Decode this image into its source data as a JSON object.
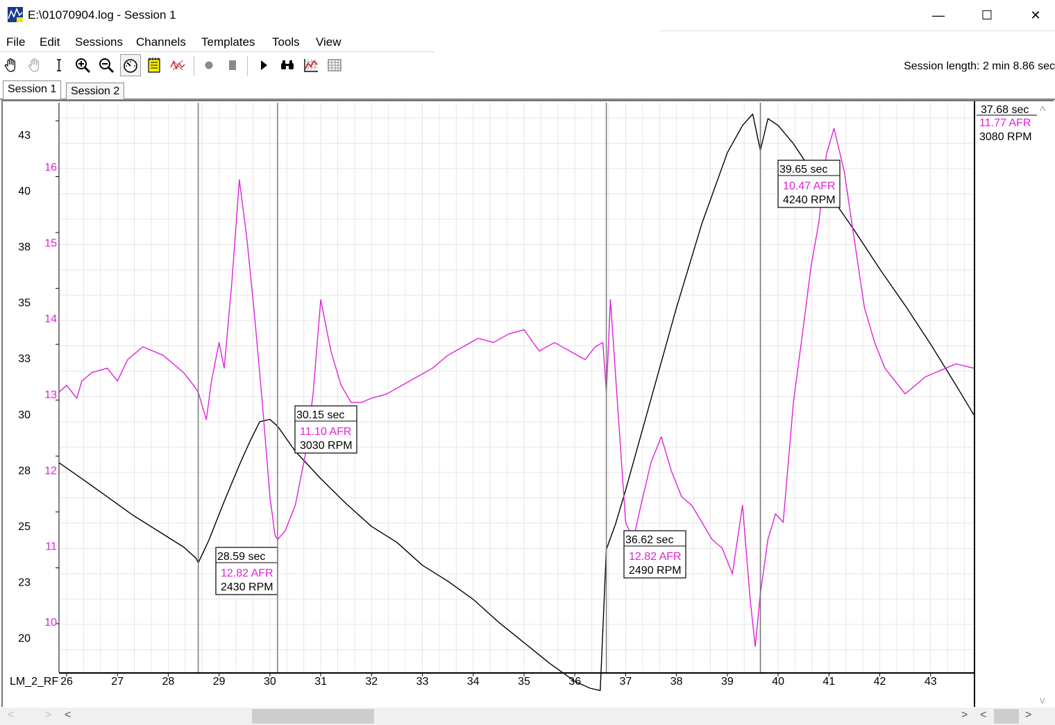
{
  "window": {
    "title": "E:\\01070904.log - Session 1",
    "minimize_glyph": "—",
    "maximize_glyph": "☐",
    "close_glyph": "✕"
  },
  "menu": [
    "File",
    "Edit",
    "Sessions",
    "Channels",
    "Templates",
    "Tools",
    "View"
  ],
  "toolbar": {
    "buttons": [
      "hand-pan",
      "hand-disabled",
      "text-cursor",
      "zoom-in",
      "zoom-out",
      "gauge",
      "notepad",
      "signal-fade",
      "record",
      "stop",
      "play",
      "binoculars",
      "chart-export",
      "table-grid"
    ],
    "pressed": "gauge",
    "session_length_label": "Session length:",
    "session_length_value": "2 min 8.86 sec"
  },
  "tabs": [
    "Session 1",
    "Session 2"
  ],
  "active_tab": "Session 1",
  "chart_data": {
    "type": "line",
    "x_axis": {
      "label": "LM_2_RF",
      "range": [
        25.85,
        43.85
      ],
      "ticks": [
        26,
        27,
        28,
        29,
        30,
        31,
        32,
        33,
        34,
        35,
        36,
        37,
        38,
        39,
        40,
        41,
        42,
        43
      ]
    },
    "rpm_axis": {
      "tick_labels": [
        "43",
        "40",
        "38",
        "35",
        "33",
        "30",
        "28",
        "25",
        "23",
        "20"
      ],
      "range": [
        1950,
        4450
      ]
    },
    "afr_axis": {
      "tick_labels": [
        "16",
        "15",
        "14",
        "13",
        "12",
        "11",
        "10"
      ],
      "range": [
        9.55,
        16.2
      ],
      "color": "#e020d8"
    },
    "grid": true,
    "series": [
      {
        "name": "RPM",
        "color": "#000000",
        "x": [
          25.85,
          26.3,
          26.8,
          27.3,
          27.8,
          28.3,
          28.55,
          28.59,
          28.8,
          29.1,
          29.4,
          29.6,
          29.8,
          30.0,
          30.15,
          30.5,
          31.0,
          31.5,
          32.0,
          32.5,
          33.0,
          33.5,
          34.0,
          34.5,
          35.0,
          35.5,
          36.0,
          36.3,
          36.5,
          36.62,
          36.8,
          37.0,
          37.5,
          38.0,
          38.5,
          39.0,
          39.3,
          39.5,
          39.65,
          39.8,
          40.0,
          40.3,
          40.6,
          41.0,
          41.5,
          42.0,
          42.5,
          43.0,
          43.5,
          43.85
        ],
        "values": [
          2870,
          2800,
          2720,
          2640,
          2570,
          2500,
          2450,
          2430,
          2530,
          2700,
          2860,
          2960,
          3050,
          3060,
          3030,
          2920,
          2800,
          2690,
          2590,
          2520,
          2420,
          2350,
          2270,
          2170,
          2080,
          1990,
          1910,
          1880,
          1870,
          2490,
          2600,
          2750,
          3150,
          3550,
          3920,
          4230,
          4350,
          4400,
          4240,
          4380,
          4350,
          4270,
          4170,
          4050,
          3890,
          3720,
          3560,
          3390,
          3210,
          3080
        ]
      },
      {
        "name": "AFR",
        "color": "#e020d8",
        "x": [
          25.85,
          26.0,
          26.2,
          26.3,
          26.5,
          26.8,
          27.0,
          27.2,
          27.5,
          27.7,
          27.9,
          28.1,
          28.3,
          28.5,
          28.59,
          28.75,
          28.85,
          29.0,
          29.1,
          29.25,
          29.4,
          29.55,
          29.7,
          29.85,
          30.0,
          30.1,
          30.15,
          30.3,
          30.5,
          30.7,
          30.85,
          31.0,
          31.2,
          31.4,
          31.6,
          31.8,
          32.0,
          32.3,
          32.6,
          32.9,
          33.2,
          33.5,
          33.8,
          34.1,
          34.4,
          34.7,
          35.0,
          35.3,
          35.6,
          35.9,
          36.2,
          36.4,
          36.55,
          36.62,
          36.7,
          36.85,
          37.0,
          37.15,
          37.3,
          37.5,
          37.7,
          37.9,
          38.1,
          38.3,
          38.5,
          38.7,
          38.9,
          39.1,
          39.3,
          39.45,
          39.55,
          39.65,
          39.8,
          39.95,
          40.1,
          40.3,
          40.5,
          40.65,
          40.8,
          40.95,
          41.1,
          41.3,
          41.5,
          41.7,
          41.9,
          42.1,
          42.3,
          42.5,
          42.7,
          42.9,
          43.1,
          43.3,
          43.5,
          43.85
        ],
        "values": [
          12.82,
          12.9,
          12.75,
          12.95,
          13.05,
          13.1,
          12.95,
          13.2,
          13.35,
          13.3,
          13.25,
          13.15,
          13.05,
          12.9,
          12.82,
          12.5,
          12.95,
          13.4,
          13.1,
          14.1,
          15.3,
          14.6,
          13.7,
          12.7,
          11.6,
          11.15,
          11.1,
          11.2,
          11.5,
          12.1,
          12.8,
          13.9,
          13.3,
          12.9,
          12.7,
          12.7,
          12.75,
          12.8,
          12.9,
          13.0,
          13.1,
          13.25,
          13.35,
          13.45,
          13.4,
          13.5,
          13.55,
          13.3,
          13.4,
          13.3,
          13.2,
          13.35,
          13.4,
          12.82,
          13.9,
          12.6,
          11.3,
          11.1,
          11.5,
          12.0,
          12.3,
          11.9,
          11.6,
          11.5,
          11.3,
          11.1,
          11.0,
          10.7,
          11.5,
          10.4,
          9.85,
          10.47,
          11.1,
          11.4,
          11.3,
          12.7,
          13.6,
          14.3,
          14.8,
          15.6,
          15.9,
          15.4,
          14.6,
          13.8,
          13.4,
          13.1,
          12.95,
          12.8,
          12.9,
          13.0,
          13.05,
          13.1,
          13.15,
          13.1
        ]
      }
    ],
    "cursors": [
      {
        "time": "28.59 sec",
        "afr": "12.82 AFR",
        "rpm": "2430 RPM",
        "x": 28.59
      },
      {
        "time": "30.15 sec",
        "afr": "11.10 AFR",
        "rpm": "3030 RPM",
        "x": 30.15
      },
      {
        "time": "36.62 sec",
        "afr": "12.82 AFR",
        "rpm": "2490 RPM",
        "x": 36.62
      },
      {
        "time": "39.65 sec",
        "afr": "10.47 AFR",
        "rpm": "4240 RPM",
        "x": 39.65
      }
    ],
    "readout": {
      "time": "37.68 sec",
      "afr": "11.77 AFR",
      "rpm": "3080 RPM"
    }
  }
}
